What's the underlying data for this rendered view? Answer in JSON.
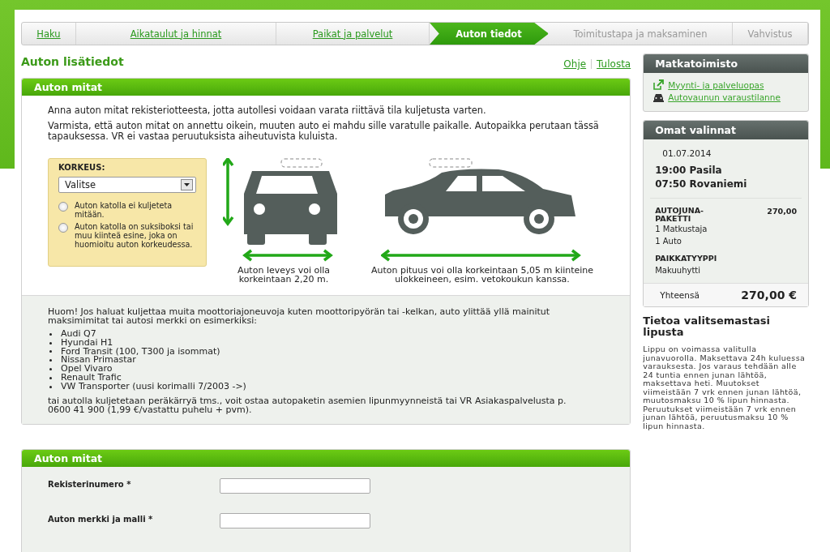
{
  "steps": [
    {
      "label": "Haku",
      "visited": true,
      "selected": false
    },
    {
      "label": "Aikataulut ja hinnat",
      "visited": true,
      "selected": false
    },
    {
      "label": "Paikat ja palvelut",
      "visited": true,
      "selected": false
    },
    {
      "label": "Auton tiedot",
      "visited": false,
      "selected": true
    },
    {
      "label": "Toimitustapa ja maksaminen",
      "visited": false,
      "selected": false
    },
    {
      "label": "Vahvistus",
      "visited": false,
      "selected": false
    }
  ],
  "page_title": "Auton lisätiedot",
  "page_links": [
    "Ohje",
    "Tulosta"
  ],
  "dimensions_panel": {
    "title": "Auton mitat",
    "intro": [
      "Anna auton mitat rekisteriotteesta, jotta autollesi voidaan varata riittävä tila kuljetusta varten.",
      "Varmista, että auton mitat on annettu oikein, muuten auto ei mahdu sille varatulle paikalle. Autopaikka perutaan tässä tapauksessa. VR ei vastaa peruutuksista aiheutuvista kuluista."
    ],
    "height_box": {
      "label": "KORKEUS:",
      "select_value": "Valitse",
      "options": [
        {
          "label": "Auton katolla ei kuljeteta mitään.",
          "checked": false
        },
        {
          "label": "Auton katolla on suksiboksi tai muu kiinteä esine, joka on huomioitu auton korkeudessa.",
          "checked": false
        }
      ]
    },
    "width_caption": "Auton leveys voi olla korkeintaan 2,20 m.",
    "length_caption": "Auton pituus voi olla korkeintaan 5,05 m kiinteine ulokkeineen, esim. vetokoukun kanssa.",
    "note": "Huom! Jos haluat kuljettaa muita moottoriajoneuvoja kuten moottoripyörän tai -kelkan, auto ylittää yllä mainitut maksimimitat tai autosi merkki on esimerkiksi:",
    "models": [
      "Audi Q7",
      "Hyundai H1",
      "Ford Transit (100, T300 ja isommat)",
      "Nissan Primastar",
      "Opel Vivaro",
      "Renault Trafic",
      "VW Transporter (uusi korimalli 7/2003 ->)"
    ],
    "note_end": "tai autolla kuljetetaan peräkärryä tms., voit ostaa autopaketin asemien lipunmyynneistä tai VR Asiakaspalvelusta p. 0600 41 900 (1,99 €/vastattu puhelu + pvm)."
  },
  "form_panel": {
    "title": "Auton mitat",
    "fields": [
      {
        "label": "Rekisterinumero *"
      },
      {
        "label": "Auton merkki ja malli *"
      }
    ]
  },
  "sidebar": {
    "agency": {
      "title": "Matkatoimisto",
      "links": [
        {
          "label": "Myynti- ja palveluopas",
          "kind": "external"
        },
        {
          "label": "Autovaunun varaustilanne",
          "kind": "car"
        }
      ]
    },
    "selections": {
      "title": "Omat valinnat",
      "date": "01.07.2014",
      "departure": "19:00 Pasila",
      "arrival": "07:50 Rovaniemi",
      "product": "AUTOJUNA-PAKETTI",
      "product_price": "270,00",
      "items": [
        "1 Matkustaja",
        "1 Auto"
      ],
      "seat_heading": "PAIKKATYYPPI",
      "seat_type": "Makuuhytti",
      "total_label": "Yhteensä",
      "total": "270,00 €"
    },
    "ticket_info": {
      "title": "Tietoa valitsemastasi lipusta",
      "text": "Lippu on voimassa valitulla junavuorolla. Maksettava 24h kuluessa varauksesta. Jos varaus tehdään alle 24 tuntia ennen junan lähtöä, maksettava heti. Muutokset viimeistään 7 vrk ennen junan lähtöä, muutosmaksu 10 % lipun hinnasta. Peruutukset viimeistään 7 vrk ennen junan lähtöä, peruutusmaksu 10 % lipun hinnasta."
    }
  }
}
